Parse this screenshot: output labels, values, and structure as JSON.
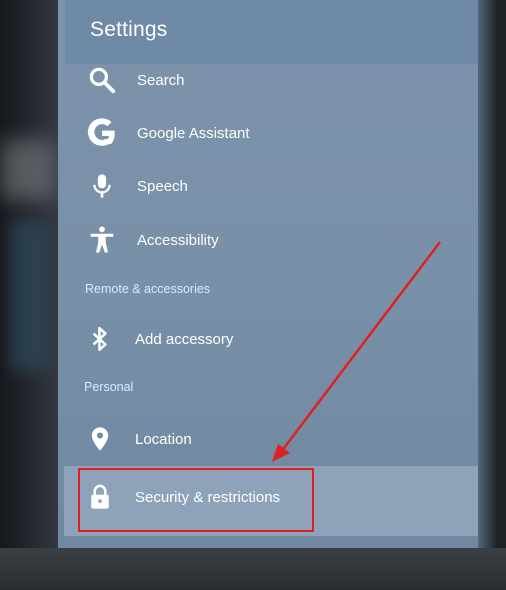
{
  "header": {
    "title": "Settings"
  },
  "items": [
    {
      "label": "Search",
      "icon": "search-icon"
    },
    {
      "label": "Google Assistant",
      "icon": "google-icon"
    },
    {
      "label": "Speech",
      "icon": "microphone-icon"
    },
    {
      "label": "Accessibility",
      "icon": "accessibility-icon"
    }
  ],
  "sections": {
    "remote": {
      "title": "Remote & accessories",
      "items": [
        {
          "label": "Add accessory",
          "icon": "bluetooth-icon"
        }
      ]
    },
    "personal": {
      "title": "Personal",
      "items": [
        {
          "label": "Location",
          "icon": "location-pin-icon"
        },
        {
          "label": "Security & restrictions",
          "icon": "lock-icon"
        }
      ]
    }
  },
  "colors": {
    "annotation": "#e02020",
    "panel": "#7890a8",
    "text": "#ffffff"
  }
}
